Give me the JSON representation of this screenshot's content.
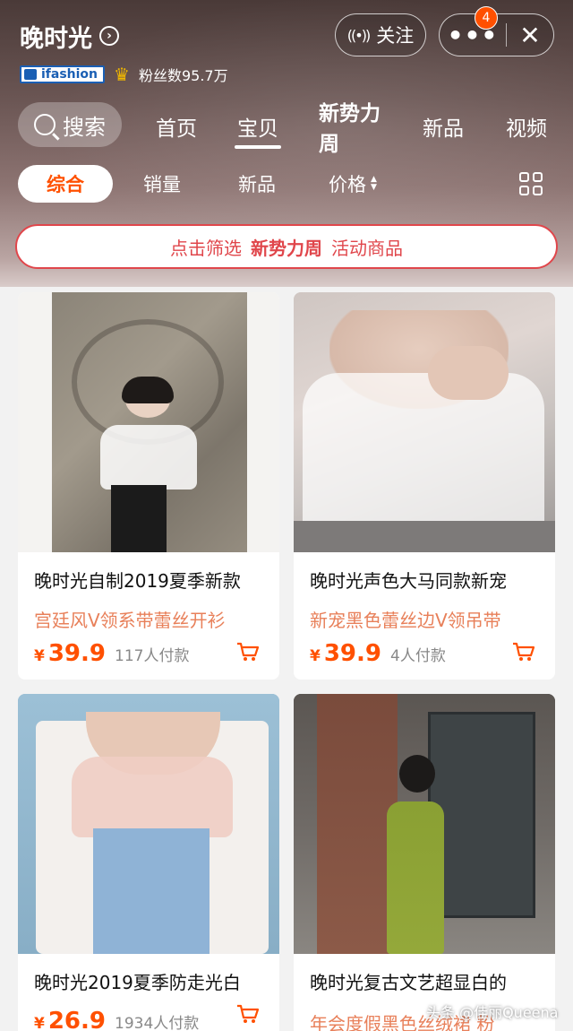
{
  "header": {
    "shop_name": "晚时光",
    "follow_label": "关注",
    "more_label": "•••",
    "close_label": "✕",
    "badge_count": "4"
  },
  "meta": {
    "brand": "ifashion",
    "fans": "粉丝数95.7万"
  },
  "tabs": {
    "search_label": "搜索",
    "items": [
      {
        "label": "首页"
      },
      {
        "label": "宝贝"
      },
      {
        "label": "新势力周"
      },
      {
        "label": "新品"
      },
      {
        "label": "视频"
      }
    ]
  },
  "sort": {
    "items": [
      {
        "label": "综合"
      },
      {
        "label": "销量"
      },
      {
        "label": "新品"
      },
      {
        "label": "价格"
      }
    ]
  },
  "banner": {
    "part1": "点击筛选",
    "part2": "新势力周",
    "part3": "活动商品"
  },
  "products": [
    {
      "title": "晚时光自制2019夏季新款",
      "subtitle": "宫廷风V领系带蕾丝开衫",
      "currency": "¥",
      "price": "39.9",
      "sold": "117人付款"
    },
    {
      "title": "晚时光声色大马同款新宠",
      "subtitle": "新宠黑色蕾丝边V领吊带",
      "currency": "¥",
      "price": "39.9",
      "sold": "4人付款"
    },
    {
      "title": "晚时光2019夏季防走光白",
      "subtitle": "",
      "currency": "¥",
      "price": "26.9",
      "sold": "1934人付款"
    },
    {
      "title": "晚时光复古文艺超显白的",
      "subtitle": "年会度假黑色丝绒裙 粉",
      "currency": "",
      "price": "",
      "sold": ""
    }
  ],
  "watermark": "头条 @佳丽Queena",
  "colors": {
    "accent": "#ff5000",
    "banner_red": "#e0464b",
    "subtitle_orange": "#e8805a"
  }
}
